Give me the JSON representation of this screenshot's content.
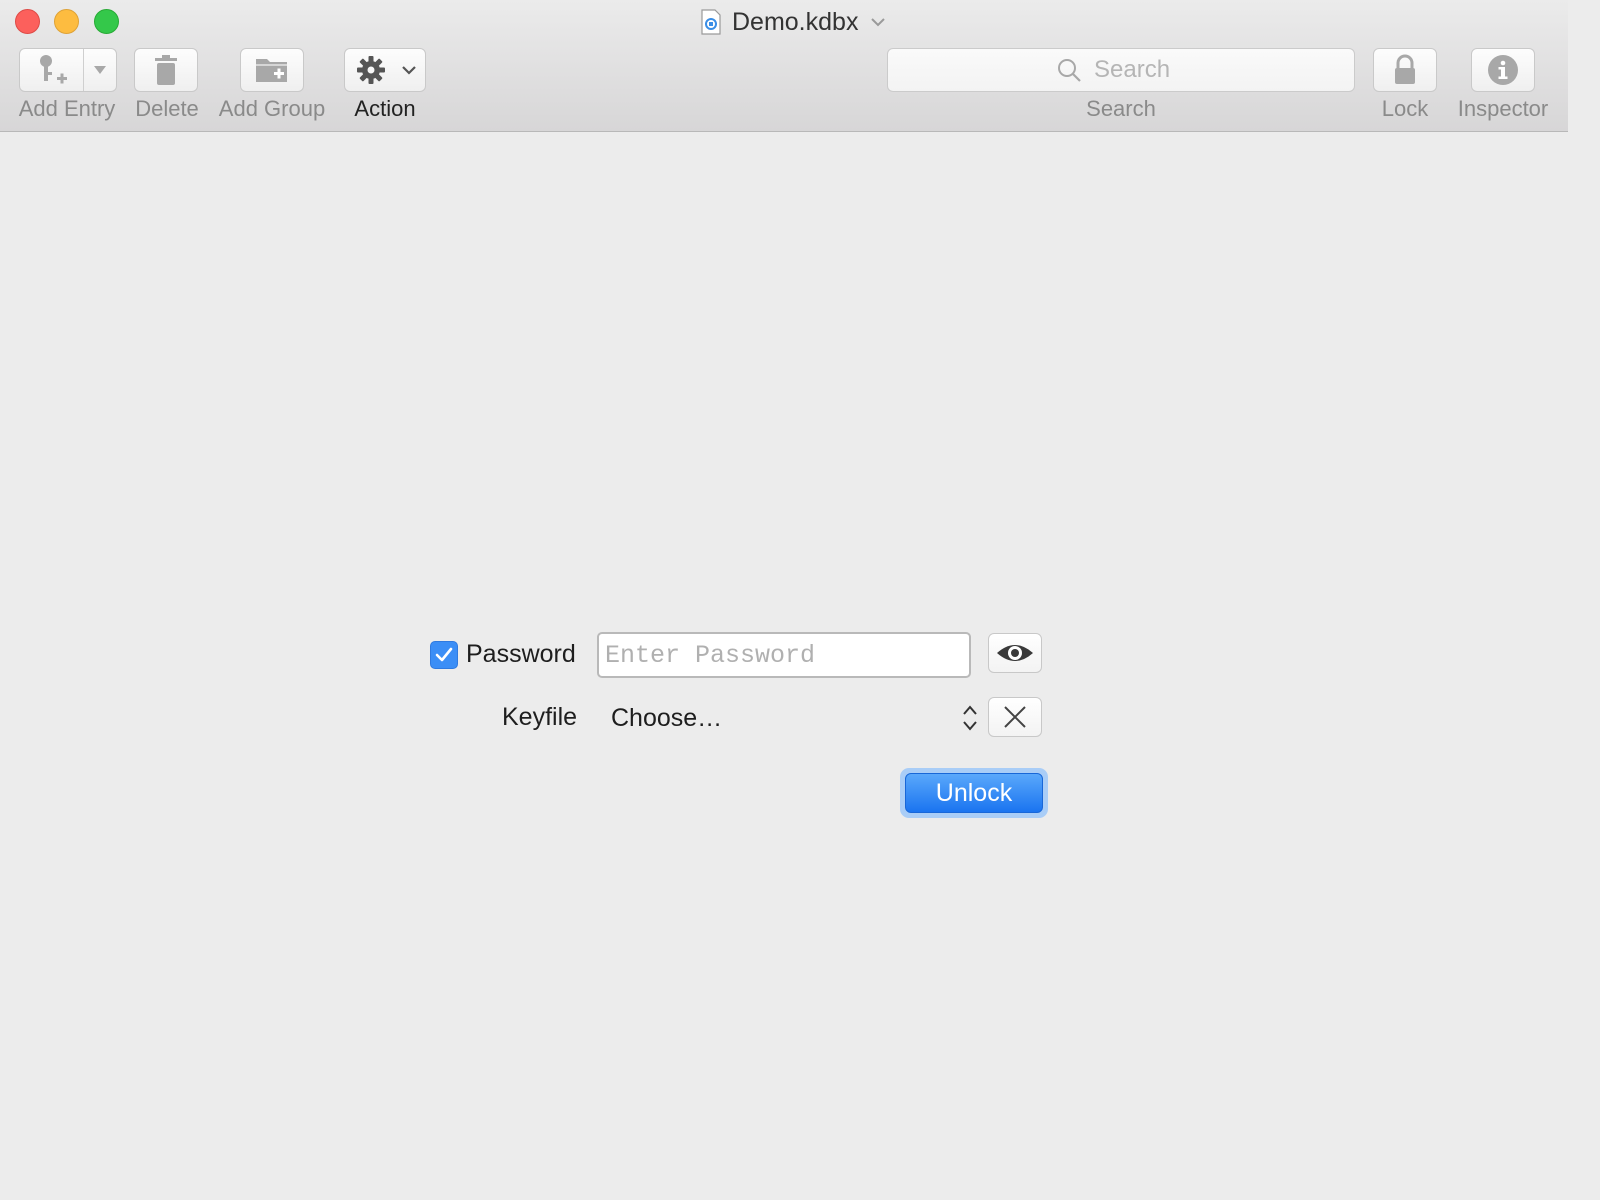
{
  "window": {
    "title": "Demo.kdbx"
  },
  "toolbar": {
    "add_entry_label": "Add Entry",
    "delete_label": "Delete",
    "add_group_label": "Add Group",
    "action_label": "Action",
    "search_label": "Search",
    "search_placeholder": "Search",
    "lock_label": "Lock",
    "inspector_label": "Inspector"
  },
  "unlock_form": {
    "password_label": "Password",
    "password_checked": true,
    "password_placeholder": "Enter Password",
    "keyfile_label": "Keyfile",
    "keyfile_value": "Choose…",
    "unlock_label": "Unlock"
  },
  "colors": {
    "accent": "#1a74f0",
    "checkbox": "#3b8ef6",
    "close": "#fc605c",
    "minimize": "#fdbc40",
    "maximize": "#34c84a"
  },
  "icons": {
    "add_entry": "key-plus-icon",
    "delete": "trash-icon",
    "add_group": "folder-plus-icon",
    "action": "gear-icon",
    "search": "magnifier-icon",
    "lock": "lock-icon",
    "inspector": "info-icon",
    "reveal": "eye-icon",
    "clear_keyfile": "close-icon"
  }
}
